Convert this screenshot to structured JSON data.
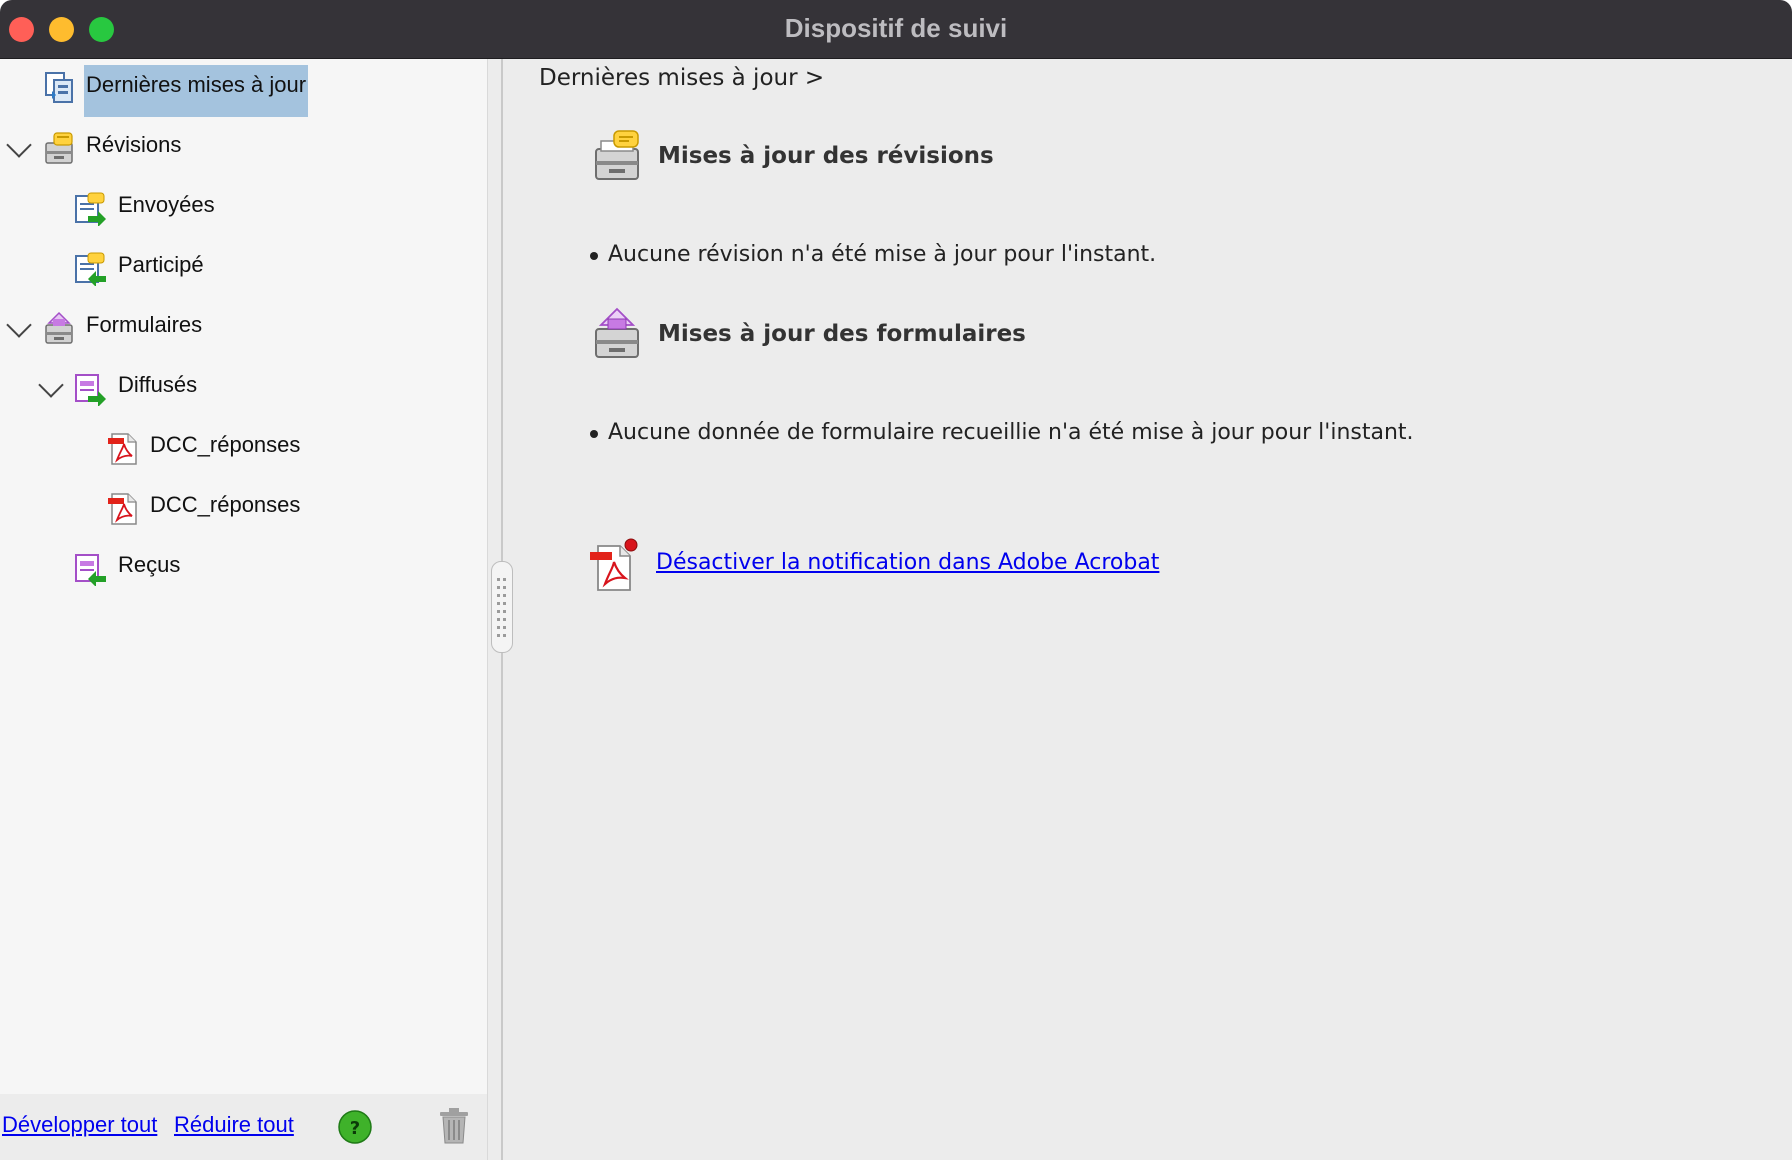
{
  "window": {
    "title": "Dispositif de suivi"
  },
  "sidebar": {
    "items": [
      {
        "label": "Dernières mises à jour",
        "icon": "latest-updates-icon",
        "selected": true
      },
      {
        "label": "Révisions",
        "icon": "reviews-tray-icon",
        "expanded": true
      },
      {
        "label": "Envoyées",
        "icon": "sent-reviews-icon"
      },
      {
        "label": "Participé",
        "icon": "joined-reviews-icon"
      },
      {
        "label": "Formulaires",
        "icon": "forms-tray-icon",
        "expanded": true
      },
      {
        "label": "Diffusés",
        "icon": "distributed-forms-icon",
        "expanded": true
      },
      {
        "label": "DCC_réponses",
        "icon": "pdf-icon"
      },
      {
        "label": "DCC_réponses",
        "icon": "pdf-icon"
      },
      {
        "label": "Reçus",
        "icon": "received-forms-icon"
      }
    ],
    "footer": {
      "expand_all": "Développer tout",
      "collapse_all": "Réduire tout",
      "help_icon": "help-icon",
      "trash_icon": "trash-icon"
    }
  },
  "content": {
    "breadcrumb": "Dernières mises à jour >",
    "sections": [
      {
        "title": "Mises à jour des révisions",
        "icon": "reviews-tray-icon",
        "message": "Aucune révision n'a été mise à jour pour l'instant."
      },
      {
        "title": "Mises à jour des formulaires",
        "icon": "forms-tray-icon",
        "message": "Aucune donnée de formulaire recueillie n'a été mise à jour pour l'instant."
      }
    ],
    "notification_link": "Désactiver la notification dans Adobe Acrobat"
  },
  "colors": {
    "titlebar": "#353338",
    "selection": "#a4c3de",
    "link": "#0000ee",
    "close": "#ff5f57",
    "minimize": "#febc2e",
    "maximize": "#28c840"
  }
}
